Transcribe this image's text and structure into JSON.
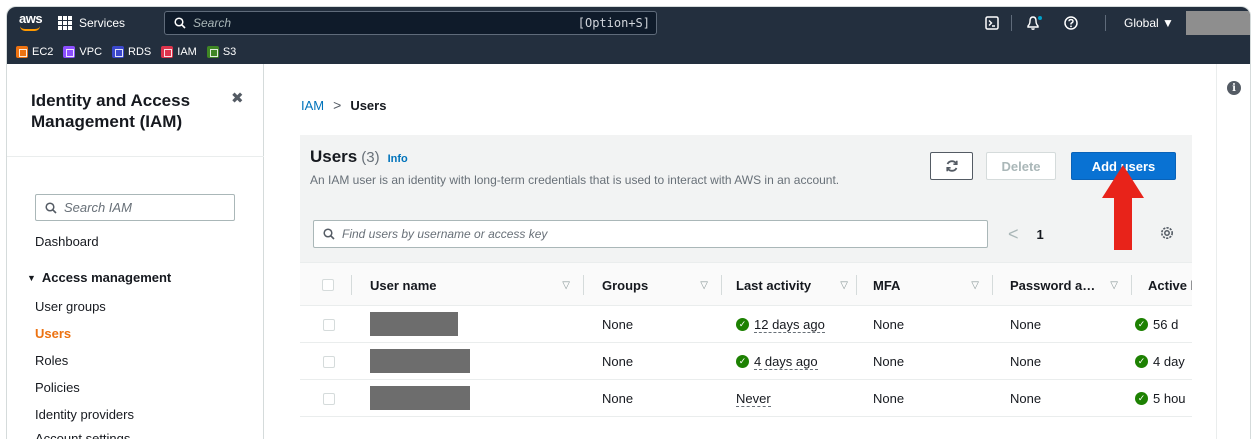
{
  "topnav": {
    "logo": "aws",
    "services_label": "Services",
    "search_placeholder": "Search",
    "search_shortcut": "[Option+S]",
    "region": "Global ▼"
  },
  "favorites": [
    {
      "label": "EC2",
      "color": "#ec7211"
    },
    {
      "label": "VPC",
      "color": "#8c4fff"
    },
    {
      "label": "RDS",
      "color": "#3b48cc"
    },
    {
      "label": "IAM",
      "color": "#dd344c"
    },
    {
      "label": "S3",
      "color": "#3f8624"
    }
  ],
  "sidebar": {
    "title": "Identity and Access Management (IAM)",
    "close_glyph": "✖",
    "search_placeholder": "Search IAM",
    "dashboard": "Dashboard",
    "section": "Access management",
    "items": [
      "User groups",
      "Users",
      "Roles",
      "Policies",
      "Identity providers",
      "Account settings"
    ]
  },
  "breadcrumb": {
    "root": "IAM",
    "sep": ">",
    "current": "Users"
  },
  "panel": {
    "title": "Users",
    "count": "(3)",
    "info": "Info",
    "description": "An IAM user is an identity with long-term credentials that is used to interact with AWS in an account.",
    "delete_label": "Delete",
    "add_label": "Add users",
    "filter_placeholder": "Find users by username or access key",
    "page": "1",
    "prev": "<"
  },
  "table": {
    "columns": [
      "User name",
      "Groups",
      "Last activity",
      "MFA",
      "Password a…",
      "Active k"
    ],
    "sort_glyph": "▽",
    "rows": [
      {
        "groups": "None",
        "last_activity": "12 days ago",
        "mfa": "None",
        "password": "None",
        "active_key": "56 d"
      },
      {
        "groups": "None",
        "last_activity": "4 days ago",
        "mfa": "None",
        "password": "None",
        "active_key": "4 day"
      },
      {
        "groups": "None",
        "last_activity": "Never",
        "mfa": "None",
        "password": "None",
        "active_key": "5 hou"
      }
    ]
  },
  "colors": {
    "accent": "#0972d3",
    "nav_bg": "#232f3e",
    "active_link": "#ec7211",
    "success": "#1d8102",
    "arrow": "#e8231a"
  }
}
